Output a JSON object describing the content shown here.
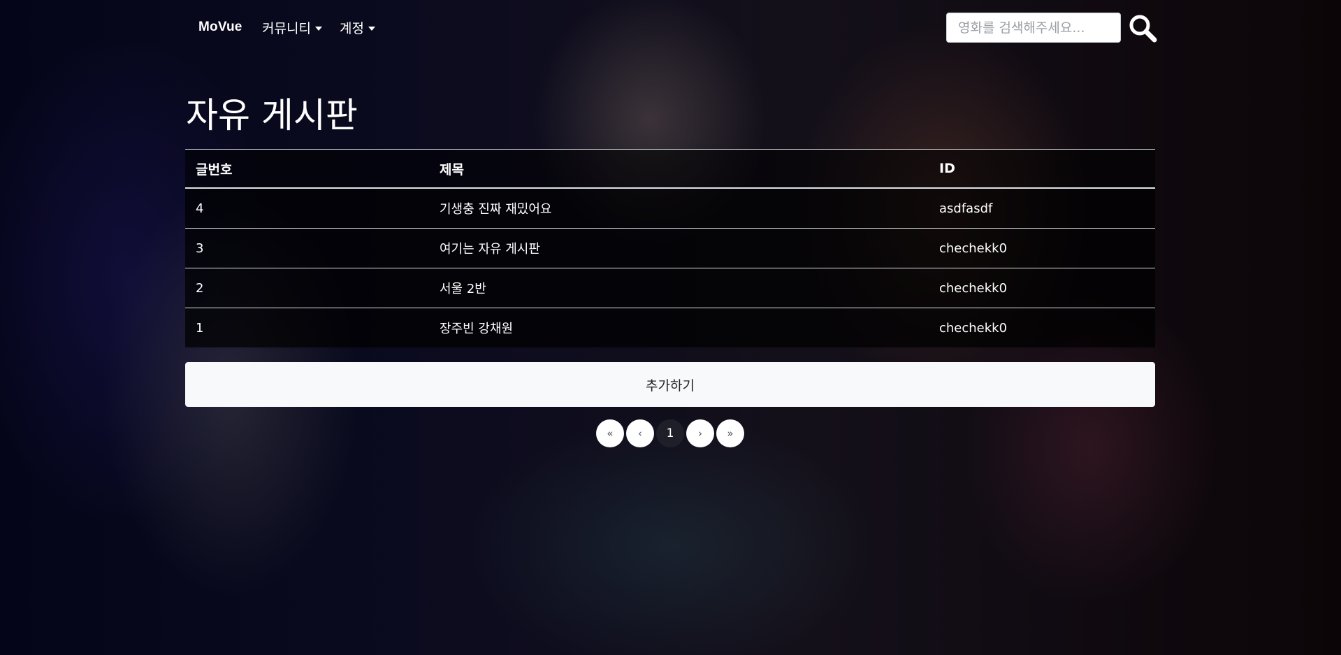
{
  "navbar": {
    "brand": "MoVue",
    "menus": [
      {
        "label": "커뮤니티"
      },
      {
        "label": "계정"
      }
    ],
    "search": {
      "placeholder": "영화를 검색해주세요...",
      "value": ""
    }
  },
  "board": {
    "title": "자유 게시판",
    "columns": [
      "글번호",
      "제목",
      "ID"
    ],
    "rows": [
      {
        "no": "4",
        "title": "기생충 진짜 재밌어요",
        "id": "asdfasdf"
      },
      {
        "no": "3",
        "title": "여기는 자유 게시판",
        "id": "chechekk0"
      },
      {
        "no": "2",
        "title": "서울 2반",
        "id": "chechekk0"
      },
      {
        "no": "1",
        "title": "장주빈 강채원",
        "id": "chechekk0"
      }
    ],
    "add_label": "추가하기"
  },
  "pagination": {
    "first": "«",
    "prev": "‹",
    "current": "1",
    "next": "›",
    "last": "»"
  },
  "colors": {
    "active_page": "#1f1f29",
    "add_button_bg": "#f8f9fa"
  }
}
